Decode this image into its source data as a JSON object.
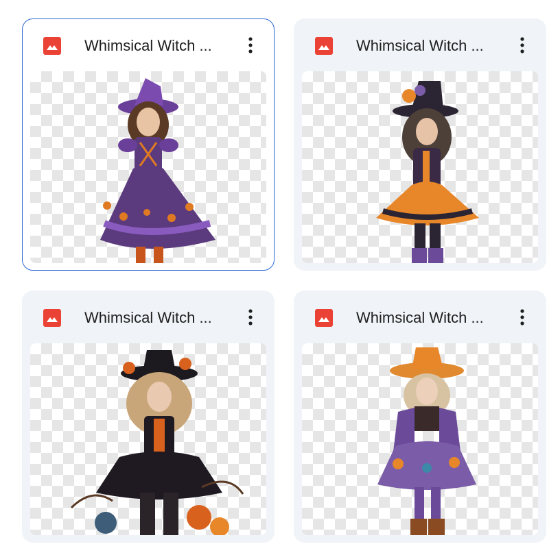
{
  "files": [
    {
      "name": "Whimsical Witch ...",
      "icon": "image-file-icon",
      "selected": true,
      "hat_color": "#6a3f9a",
      "dress_color": "#5b3b7e",
      "accent_color": "#e07a22"
    },
    {
      "name": "Whimsical Witch ...",
      "icon": "image-file-icon",
      "selected": false,
      "hat_color": "#2b2433",
      "dress_color": "#3a2a45",
      "accent_color": "#e8872a"
    },
    {
      "name": "Whimsical Witch ...",
      "icon": "image-file-icon",
      "selected": false,
      "hat_color": "#1d1a1f",
      "dress_color": "#1f1a22",
      "accent_color": "#d9611e"
    },
    {
      "name": "Whimsical Witch ...",
      "icon": "image-file-icon",
      "selected": false,
      "hat_color": "#e0892f",
      "dress_color": "#6b4a9a",
      "accent_color": "#e8872a"
    }
  ],
  "colors": {
    "icon_red": "#ea4335",
    "selection_border": "#2b66d4",
    "card_bg": "#f0f3f8"
  }
}
